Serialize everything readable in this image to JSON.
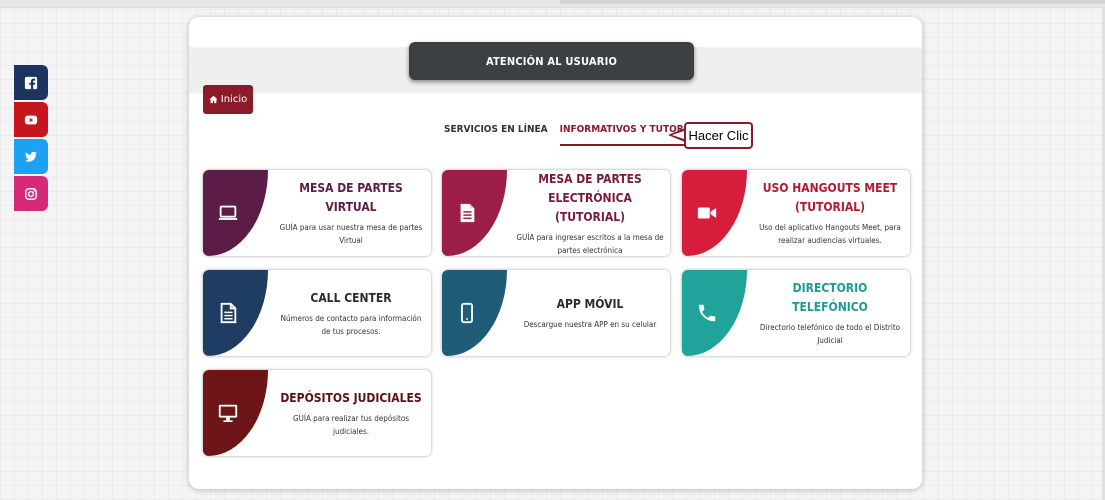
{
  "colors": {
    "accent": "#8b1a2b",
    "header_bg": "#3c4043"
  },
  "header": {
    "title": "ATENCIÓN AL USUARIO"
  },
  "nav": {
    "inicio_label": "Inicio",
    "inicio_icon": "home-icon"
  },
  "tabs": [
    {
      "label": "SERVICIOS EN LÍNEA",
      "active": false
    },
    {
      "label": "INFORMATIVOS Y TUTORIALES",
      "active": true
    }
  ],
  "callout": {
    "label": "Hacer Clic"
  },
  "social": [
    {
      "name": "facebook-icon",
      "color": "#1d3460"
    },
    {
      "name": "youtube-icon",
      "color": "#c4161c"
    },
    {
      "name": "twitter-icon",
      "color": "#1da1f2"
    },
    {
      "name": "instagram-icon",
      "color": "#d62976"
    }
  ],
  "cards": [
    {
      "title": "MESA DE PARTES VIRTUAL",
      "desc": "GUÍA para usar nuestra mesa de partes Virtual",
      "color": "#5b1c46",
      "title_color": "#5b1c46",
      "icon": "laptop-icon"
    },
    {
      "title": "MESA DE PARTES ELECTRÓNICA (TUTORIAL)",
      "desc": "GUÍA para ingresar escritos a la mesa de partes electrónica",
      "color": "#9c1e46",
      "title_color": "#7a1a3a",
      "icon": "document-icon"
    },
    {
      "title": "USO HANGOUTS MEET (TUTORIAL)",
      "desc": "Uso del aplicativo Hangouts Meet, para realizar audiencias virtuales.",
      "color": "#d61e3c",
      "title_color": "#b5172f",
      "icon": "video-camera-icon"
    },
    {
      "title": "CALL CENTER",
      "desc": "Números de contacto para información de tus procesos.",
      "color": "#1f3d63",
      "title_color": "#2b2b2b",
      "icon": "file-text-icon"
    },
    {
      "title": "APP MÓVIL",
      "desc": "Descargue nuestra APP en su celular",
      "color": "#1f5c78",
      "title_color": "#2b2b2b",
      "icon": "mobile-phone-icon"
    },
    {
      "title": "DIRECTORIO TELEFÓNICO",
      "desc": "Directorio telefónico de todo el Distrito Judicial",
      "color": "#1fa39a",
      "title_color": "#1f9a92",
      "icon": "phone-icon"
    },
    {
      "title": "DEPÓSITOS JUDICIALES",
      "desc": "GUÍA para realizar tus depósitos judiciales.",
      "color": "#6e1518",
      "title_color": "#5a1216",
      "icon": "monitor-icon"
    }
  ]
}
